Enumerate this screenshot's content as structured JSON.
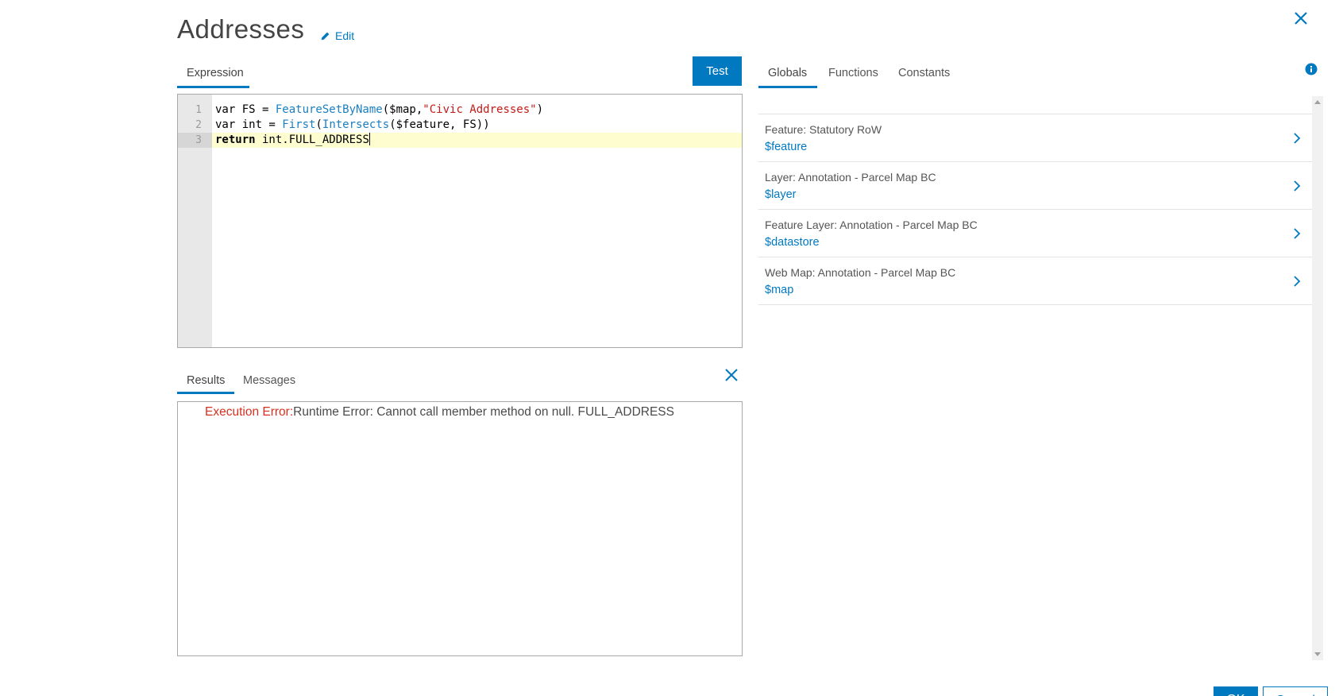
{
  "header": {
    "title": "Addresses",
    "edit_label": "Edit"
  },
  "left_tabs": {
    "expression": "Expression"
  },
  "test_button": "Test",
  "right_tabs": {
    "globals": "Globals",
    "functions": "Functions",
    "constants": "Constants"
  },
  "editor": {
    "lines": [
      {
        "num": "1",
        "parts": [
          "var FS = ",
          "FeatureSetByName",
          "($map,",
          "\"Civic Addresses\"",
          ")"
        ]
      },
      {
        "num": "2",
        "parts": [
          "var int = ",
          "First",
          "(",
          "Intersects",
          "($feature, FS))"
        ]
      },
      {
        "num": "3",
        "parts": [
          "return",
          " int.FULL_ADDRESS"
        ]
      }
    ]
  },
  "results_tabs": {
    "results": "Results",
    "messages": "Messages"
  },
  "results": {
    "error_label": "Execution Error:",
    "error_message": "Runtime Error: Cannot call member method on null. FULL_ADDRESS"
  },
  "globals": [
    {
      "label": "Feature: Statutory RoW",
      "var": "$feature"
    },
    {
      "label": "Layer: Annotation - Parcel Map BC",
      "var": "$layer"
    },
    {
      "label": "Feature Layer: Annotation - Parcel Map BC",
      "var": "$datastore"
    },
    {
      "label": "Web Map: Annotation - Parcel Map BC",
      "var": "$map"
    }
  ],
  "footer": {
    "ok_label": "OK",
    "cancel_label": "Cancel"
  },
  "colors": {
    "accent": "#0079c1",
    "error": "#d83020",
    "string": "#c41a16",
    "current_line": "#fdfdd0"
  }
}
